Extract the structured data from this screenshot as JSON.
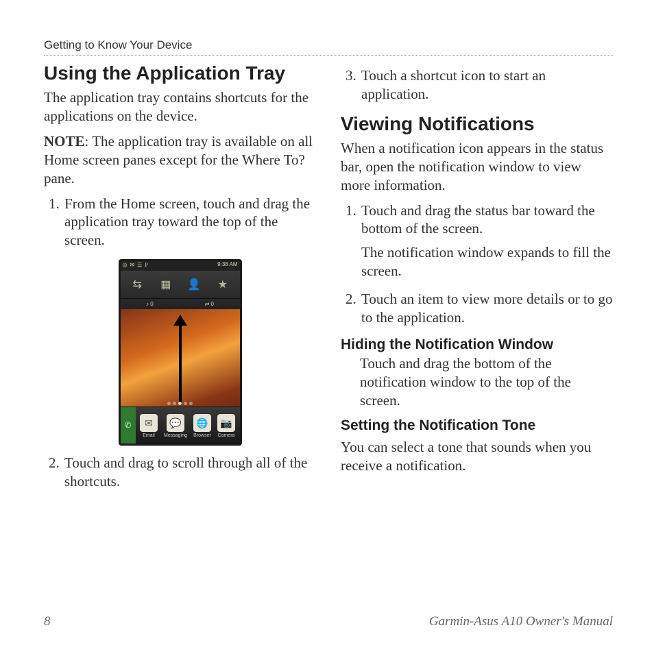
{
  "header": "Getting to Know Your Device",
  "left": {
    "h2": "Using the Application Tray",
    "intro": "The application tray contains shortcuts for the applications on the device.",
    "note_label": "NOTE",
    "note_body": ": The application tray is available on all Home screen panes except for the Where To? pane.",
    "step1": "From the Home screen, touch and drag the application tray toward the top of the screen.",
    "step2": "Touch and drag to scroll through all of the shortcuts."
  },
  "phone": {
    "time": "9:38 AM",
    "status_left": "◎ ✉ ☰ P",
    "tray_row2_left": "♪ 0",
    "tray_row2_right": "⇄ 0",
    "dock_items": [
      {
        "label": "Email",
        "glyph": "✉"
      },
      {
        "label": "Messaging",
        "glyph": "💬"
      },
      {
        "label": "Browser",
        "glyph": "🌐"
      },
      {
        "label": "Camera",
        "glyph": "📷"
      }
    ]
  },
  "right": {
    "step3": "Touch a shortcut icon to start an application.",
    "h2": "Viewing Notifications",
    "intro": "When a notification icon appears in the status bar, open the notification window to view more information.",
    "vn_step1": "Touch and drag the status bar toward the bottom of the screen.",
    "vn_step1_extra": "The notification window expands to fill the screen.",
    "vn_step2": "Touch an item to view more details or to go to the application.",
    "h3a": "Hiding the Notification Window",
    "h3a_body": "Touch and drag the bottom of the notification window to the top of the screen.",
    "h3b": "Setting the Notification Tone",
    "h3b_body": "You can select a tone that sounds when you receive a notification."
  },
  "footer": {
    "page": "8",
    "title": "Garmin-Asus A10 Owner's Manual"
  }
}
